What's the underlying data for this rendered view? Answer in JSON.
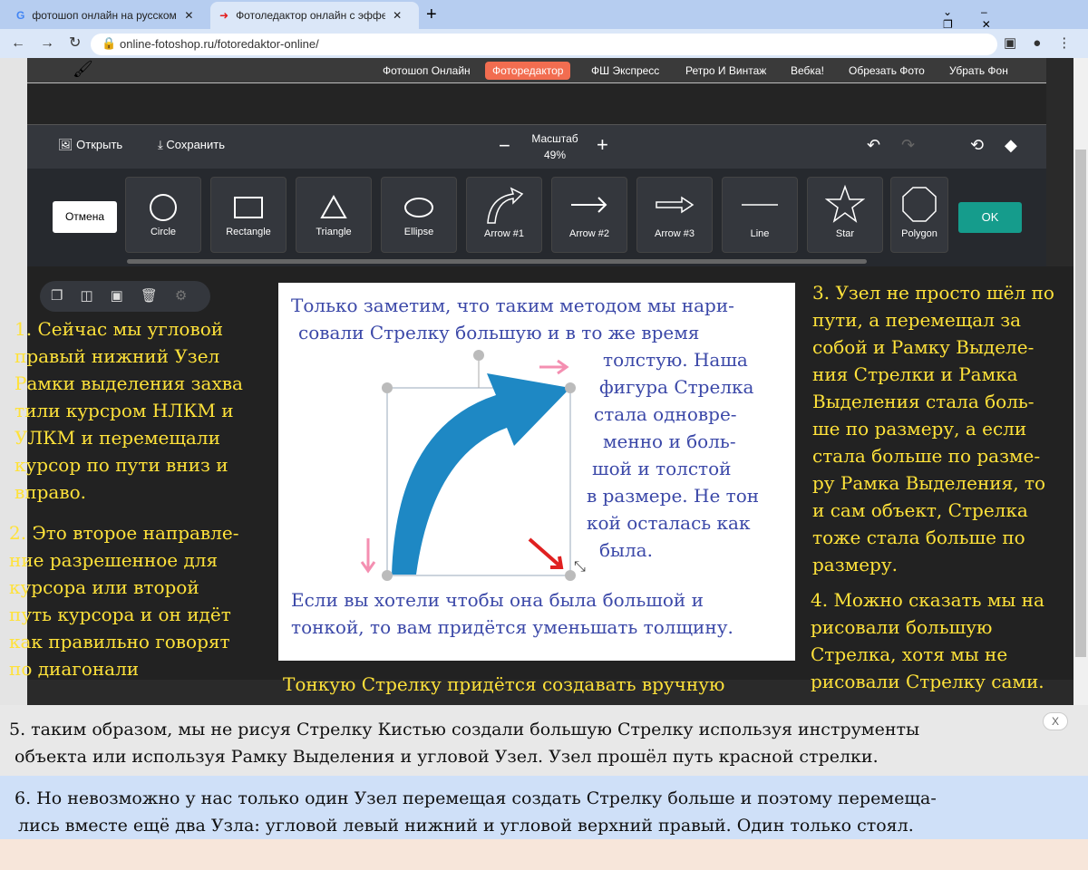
{
  "browser": {
    "tabs": [
      {
        "title": "фотошоп онлайн на русском - Г",
        "active": false
      },
      {
        "title": "Фотоледактор онлайн с эффект",
        "active": true
      }
    ],
    "url": "online-fotoshop.ru/fotoredaktor-online/"
  },
  "nav": {
    "items": [
      "Фотошоп Онлайн",
      "Фоторедактор",
      "ФШ Экспресс",
      "Ретро И Винтаж",
      "Вебка!",
      "Обрезать Фото",
      "Убрать Фон"
    ],
    "active": "Фоторедактор",
    "accent": "#f26d50"
  },
  "toolbar": {
    "open": "Открыть",
    "save": "Сохранить",
    "zoom_label": "Масштаб",
    "zoom_value": "49%"
  },
  "shapes": {
    "cancel": "Отмена",
    "ok": "OK",
    "items": [
      "Circle",
      "Rectangle",
      "Triangle",
      "Ellipse",
      "Arrow #1",
      "Arrow #2",
      "Arrow #3",
      "Line",
      "Star",
      "Polygon"
    ]
  },
  "notes": {
    "n1": [
      "1. Сейчас мы угловой",
      "правый нижний Узел",
      "Рамки выделения захва",
      "тили курсром НЛКМ и",
      "УЛКМ и перемещали",
      "курсор по пути вниз и",
      "вправо."
    ],
    "n2": [
      "2. Это второе направле-",
      "ние разрешенное для",
      "курсора или второй",
      "путь курсора и он идёт",
      "как правильно говорят",
      "по диагонали"
    ],
    "n3": [
      "3. Узел не просто шёл по",
      "пути, а перемещал за",
      "собой и Рамку Выделе-",
      "ния Стрелки и Рамка",
      "Выделения стала боль-",
      "ше по размеру, а если",
      "стала больше по разме-",
      "ру Рамка Выделения, то",
      "и сам объект, Стрелка",
      "тоже стала больше по",
      "размеру."
    ],
    "n4": [
      "4. Можно сказать мы на",
      "рисовали большую",
      "Стрелка, хотя мы не",
      "рисовали Стрелку сами."
    ],
    "canvas_top": [
      "Только заметим, что таким методом мы нари-",
      "совали Стрелку большую и в то же время"
    ],
    "canvas_right": [
      "толстую. Наша",
      "фигура Стрелка",
      "стала одновре-",
      "менно и боль-",
      "шой и толстой",
      "в размере. Не тон",
      "кой осталась как",
      "была."
    ],
    "canvas_bottom": [
      "Если вы хотели чтобы она была большой и",
      "тонкой, то вам придётся уменьшать толщину."
    ],
    "caption": "Тонкую Стрелку придётся создавать вручную",
    "n5": [
      "5. таким образом, мы не рисуя Стрелку Кистью создали большую Стрелку используя инструменты",
      "объекта или используя Рамку Выделения и угловой Узел. Узел прошёл путь красной стрелки."
    ],
    "n5_close": "X",
    "n6": [
      "6. Но невозможно у нас только один Узел перемещая создать Стрелку больше и поэтому перемеща-",
      "лись вместе ещё два Узла: угловой левый нижний и угловой верхний правый. Один только стоял."
    ]
  }
}
